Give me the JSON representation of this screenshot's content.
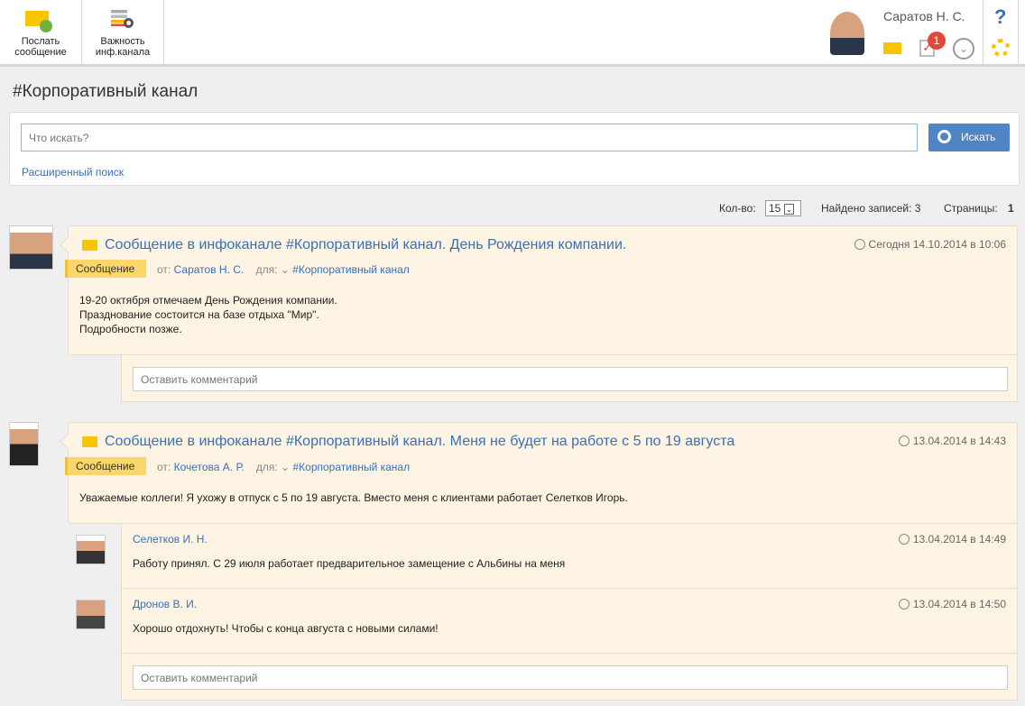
{
  "toolbar": {
    "send": "Послать сообщение",
    "importance": "Важность инф.канала"
  },
  "user": {
    "name": "Саратов Н. С.",
    "tasks_badge": "1"
  },
  "help": "?",
  "page_title": "#Корпоративный канал",
  "search": {
    "placeholder": "Что искать?",
    "button": "Искать",
    "advanced": "Расширенный поиск"
  },
  "pager": {
    "count_label": "Кол-во:",
    "count_value": "15",
    "found": "Найдено записей: 3",
    "pages_label": "Страницы:",
    "page": "1"
  },
  "posts": [
    {
      "title": "Сообщение в инфоканале #Корпоративный канал. День Рождения компании.",
      "date": "Сегодня 14.10.2014 в 10:06",
      "tag": "Сообщение",
      "from_label": "от:",
      "from": "Саратов Н. С.",
      "to_label": "для:",
      "channel": "#Корпоративный канал",
      "body": [
        "19-20 октября отмечаем День Рождения компании.",
        "Празднование состоится на базе отдыха \"Мир\".",
        "Подробности позже."
      ],
      "comment_placeholder": "Оставить комментарий"
    },
    {
      "title": "Сообщение в инфоканале #Корпоративный канал. Меня не будет на работе с 5 по 19 августа",
      "date": "13.04.2014 в 14:43",
      "tag": "Сообщение",
      "from_label": "от:",
      "from": "Кочетова А. Р.",
      "to_label": "для:",
      "channel": "#Корпоративный канал",
      "body": [
        "Уважаемые коллеги! Я ухожу в отпуск с 5 по 19 августа. Вместо меня с клиентами работает Селетков Игорь."
      ],
      "comment_placeholder": "Оставить комментарий",
      "replies": [
        {
          "author": "Селетков И. Н.",
          "date": "13.04.2014 в 14:49",
          "text": "Работу принял. С 29 июля работает предварительное замещение с Альбины на меня"
        },
        {
          "author": "Дронов В. И.",
          "date": "13.04.2014 в 14:50",
          "text": "Хорошо отдохнуть! Чтобы с конца августа с новыми силами!"
        }
      ]
    }
  ]
}
